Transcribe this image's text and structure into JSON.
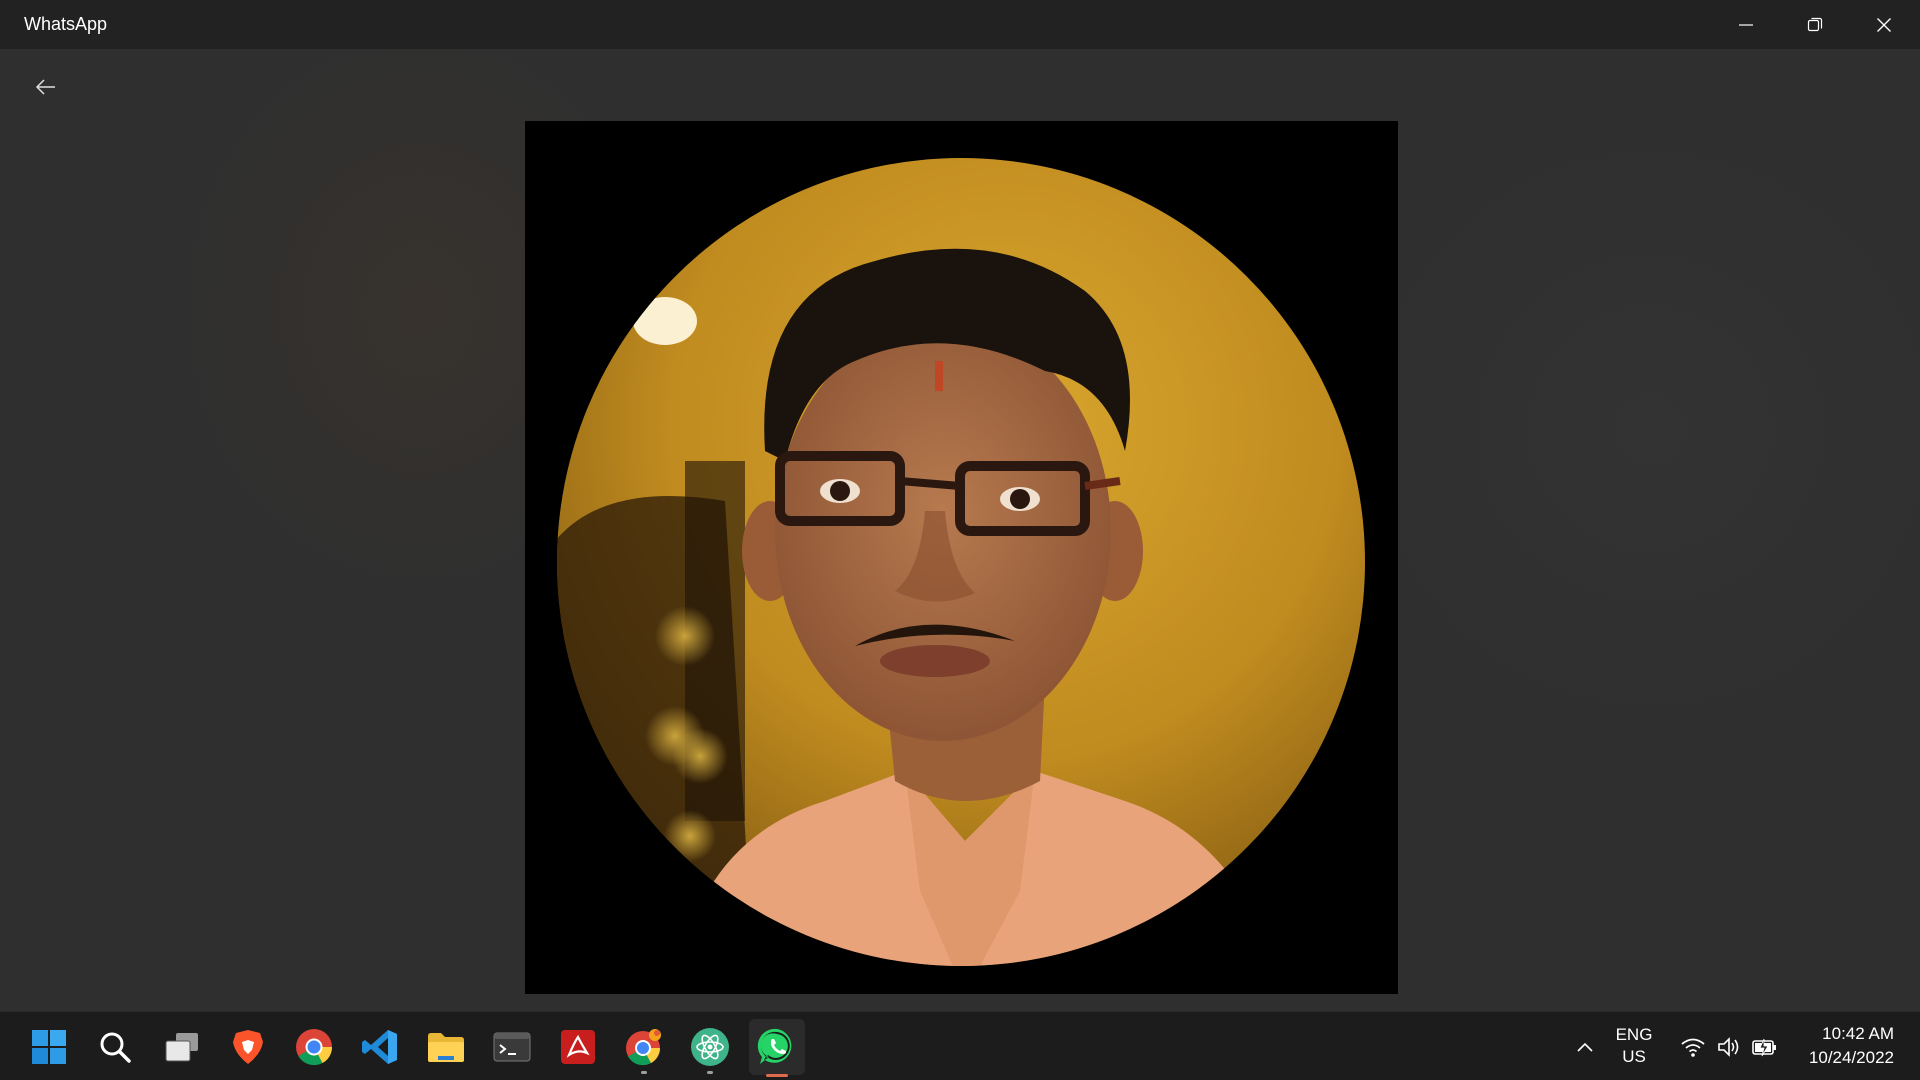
{
  "window": {
    "title": "WhatsApp",
    "controls": {
      "minimize_icon": "minimize-icon",
      "restore_icon": "restore-icon",
      "close_icon": "close-icon"
    }
  },
  "viewer": {
    "back_icon": "back-arrow-icon",
    "image": "profile-photo"
  },
  "taskbar": {
    "apps": [
      {
        "name": "Start",
        "icon": "windows-start-icon"
      },
      {
        "name": "Search",
        "icon": "search-icon"
      },
      {
        "name": "Task View",
        "icon": "task-view-icon"
      },
      {
        "name": "Brave",
        "icon": "brave-icon"
      },
      {
        "name": "Chrome",
        "icon": "chrome-icon"
      },
      {
        "name": "Visual Studio Code",
        "icon": "vscode-icon"
      },
      {
        "name": "File Explorer",
        "icon": "file-explorer-icon"
      },
      {
        "name": "Terminal",
        "icon": "terminal-icon"
      },
      {
        "name": "Adobe Acrobat",
        "icon": "acrobat-icon"
      },
      {
        "name": "Chrome Canary",
        "icon": "chrome-canary-icon"
      },
      {
        "name": "Atom",
        "icon": "atom-icon"
      },
      {
        "name": "WhatsApp",
        "icon": "whatsapp-icon"
      }
    ],
    "tray": {
      "lang_line1": "ENG",
      "lang_line2": "US",
      "time": "10:42 AM",
      "date": "10/24/2022"
    }
  },
  "colors": {
    "titlebar": "#222222",
    "content_bg": "#2f2f2f",
    "taskbar": "#1c1c1c",
    "accent_whatsapp": "#25d366"
  }
}
